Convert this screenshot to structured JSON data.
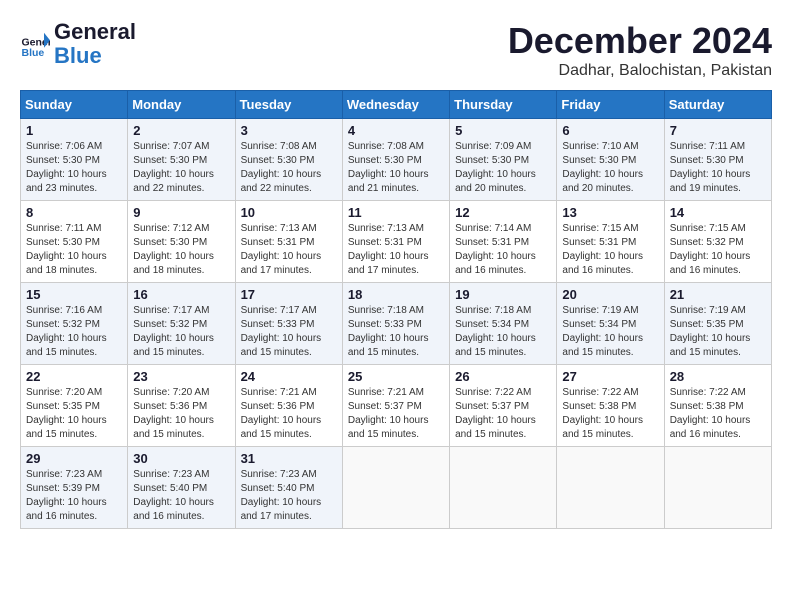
{
  "header": {
    "logo_line1": "General",
    "logo_line2": "Blue",
    "main_title": "December 2024",
    "subtitle": "Dadhar, Balochistan, Pakistan"
  },
  "calendar": {
    "days_of_week": [
      "Sunday",
      "Monday",
      "Tuesday",
      "Wednesday",
      "Thursday",
      "Friday",
      "Saturday"
    ],
    "weeks": [
      [
        {
          "day": "1",
          "detail": "Sunrise: 7:06 AM\nSunset: 5:30 PM\nDaylight: 10 hours\nand 23 minutes."
        },
        {
          "day": "2",
          "detail": "Sunrise: 7:07 AM\nSunset: 5:30 PM\nDaylight: 10 hours\nand 22 minutes."
        },
        {
          "day": "3",
          "detail": "Sunrise: 7:08 AM\nSunset: 5:30 PM\nDaylight: 10 hours\nand 22 minutes."
        },
        {
          "day": "4",
          "detail": "Sunrise: 7:08 AM\nSunset: 5:30 PM\nDaylight: 10 hours\nand 21 minutes."
        },
        {
          "day": "5",
          "detail": "Sunrise: 7:09 AM\nSunset: 5:30 PM\nDaylight: 10 hours\nand 20 minutes."
        },
        {
          "day": "6",
          "detail": "Sunrise: 7:10 AM\nSunset: 5:30 PM\nDaylight: 10 hours\nand 20 minutes."
        },
        {
          "day": "7",
          "detail": "Sunrise: 7:11 AM\nSunset: 5:30 PM\nDaylight: 10 hours\nand 19 minutes."
        }
      ],
      [
        {
          "day": "8",
          "detail": "Sunrise: 7:11 AM\nSunset: 5:30 PM\nDaylight: 10 hours\nand 18 minutes."
        },
        {
          "day": "9",
          "detail": "Sunrise: 7:12 AM\nSunset: 5:30 PM\nDaylight: 10 hours\nand 18 minutes."
        },
        {
          "day": "10",
          "detail": "Sunrise: 7:13 AM\nSunset: 5:31 PM\nDaylight: 10 hours\nand 17 minutes."
        },
        {
          "day": "11",
          "detail": "Sunrise: 7:13 AM\nSunset: 5:31 PM\nDaylight: 10 hours\nand 17 minutes."
        },
        {
          "day": "12",
          "detail": "Sunrise: 7:14 AM\nSunset: 5:31 PM\nDaylight: 10 hours\nand 16 minutes."
        },
        {
          "day": "13",
          "detail": "Sunrise: 7:15 AM\nSunset: 5:31 PM\nDaylight: 10 hours\nand 16 minutes."
        },
        {
          "day": "14",
          "detail": "Sunrise: 7:15 AM\nSunset: 5:32 PM\nDaylight: 10 hours\nand 16 minutes."
        }
      ],
      [
        {
          "day": "15",
          "detail": "Sunrise: 7:16 AM\nSunset: 5:32 PM\nDaylight: 10 hours\nand 15 minutes."
        },
        {
          "day": "16",
          "detail": "Sunrise: 7:17 AM\nSunset: 5:32 PM\nDaylight: 10 hours\nand 15 minutes."
        },
        {
          "day": "17",
          "detail": "Sunrise: 7:17 AM\nSunset: 5:33 PM\nDaylight: 10 hours\nand 15 minutes."
        },
        {
          "day": "18",
          "detail": "Sunrise: 7:18 AM\nSunset: 5:33 PM\nDaylight: 10 hours\nand 15 minutes."
        },
        {
          "day": "19",
          "detail": "Sunrise: 7:18 AM\nSunset: 5:34 PM\nDaylight: 10 hours\nand 15 minutes."
        },
        {
          "day": "20",
          "detail": "Sunrise: 7:19 AM\nSunset: 5:34 PM\nDaylight: 10 hours\nand 15 minutes."
        },
        {
          "day": "21",
          "detail": "Sunrise: 7:19 AM\nSunset: 5:35 PM\nDaylight: 10 hours\nand 15 minutes."
        }
      ],
      [
        {
          "day": "22",
          "detail": "Sunrise: 7:20 AM\nSunset: 5:35 PM\nDaylight: 10 hours\nand 15 minutes."
        },
        {
          "day": "23",
          "detail": "Sunrise: 7:20 AM\nSunset: 5:36 PM\nDaylight: 10 hours\nand 15 minutes."
        },
        {
          "day": "24",
          "detail": "Sunrise: 7:21 AM\nSunset: 5:36 PM\nDaylight: 10 hours\nand 15 minutes."
        },
        {
          "day": "25",
          "detail": "Sunrise: 7:21 AM\nSunset: 5:37 PM\nDaylight: 10 hours\nand 15 minutes."
        },
        {
          "day": "26",
          "detail": "Sunrise: 7:22 AM\nSunset: 5:37 PM\nDaylight: 10 hours\nand 15 minutes."
        },
        {
          "day": "27",
          "detail": "Sunrise: 7:22 AM\nSunset: 5:38 PM\nDaylight: 10 hours\nand 15 minutes."
        },
        {
          "day": "28",
          "detail": "Sunrise: 7:22 AM\nSunset: 5:38 PM\nDaylight: 10 hours\nand 16 minutes."
        }
      ],
      [
        {
          "day": "29",
          "detail": "Sunrise: 7:23 AM\nSunset: 5:39 PM\nDaylight: 10 hours\nand 16 minutes."
        },
        {
          "day": "30",
          "detail": "Sunrise: 7:23 AM\nSunset: 5:40 PM\nDaylight: 10 hours\nand 16 minutes."
        },
        {
          "day": "31",
          "detail": "Sunrise: 7:23 AM\nSunset: 5:40 PM\nDaylight: 10 hours\nand 17 minutes."
        },
        {
          "day": "",
          "detail": ""
        },
        {
          "day": "",
          "detail": ""
        },
        {
          "day": "",
          "detail": ""
        },
        {
          "day": "",
          "detail": ""
        }
      ]
    ]
  }
}
